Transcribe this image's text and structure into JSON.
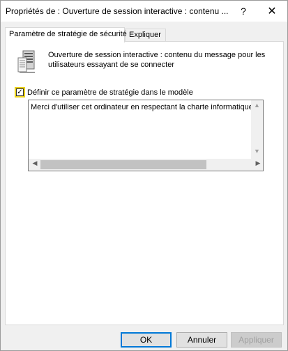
{
  "window": {
    "title": "Propriétés de : Ouverture de session interactive : contenu ...",
    "help_glyph": "?",
    "close_glyph": "✕"
  },
  "tabs": [
    {
      "label": "Paramètre de stratégie de sécurité",
      "active": true
    },
    {
      "label": "Expliquer",
      "active": false
    }
  ],
  "policy": {
    "icon": "server-policy-icon",
    "description": "Ouverture de session interactive : contenu du message pour les utilisateurs essayant de se connecter"
  },
  "define": {
    "label": "Définir ce paramètre de stratégie dans le modèle",
    "checked": true,
    "check_glyph": "✓"
  },
  "message": {
    "text": "Merci d'utiliser cet ordinateur en respectant la charte informatique de"
  },
  "scrollbars": {
    "up": "▲",
    "down": "▼",
    "left": "◀",
    "right": "▶"
  },
  "buttons": {
    "ok": "OK",
    "cancel": "Annuler",
    "apply": "Appliquer"
  },
  "colors": {
    "focus_highlight": "#ecd21a",
    "default_button_border": "#0078d7"
  }
}
